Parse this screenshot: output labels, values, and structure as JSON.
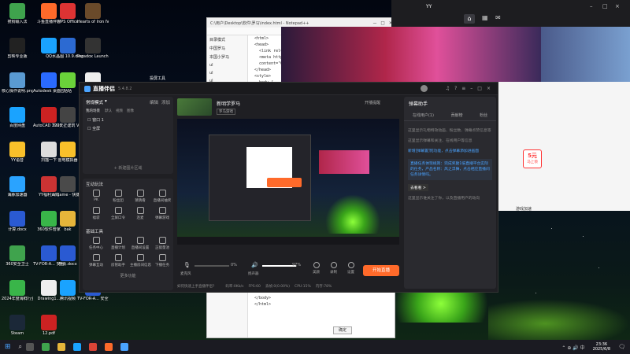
{
  "desktop": {
    "icons": [
      {
        "label": "搜狗输入法"
      },
      {
        "label": "斗鱼直播伴侣"
      },
      {
        "label": "WPS Office"
      },
      {
        "label": "Hearts of Iron IV"
      },
      {
        "label": "剪映专业版"
      },
      {
        "label": "QQ"
      },
      {
        "label": "水晶图 10.9.dwg"
      },
      {
        "label": "Paradox Launcher v2"
      },
      {
        "label": "核心操作说明.png"
      },
      {
        "label": "Autodesk 桌面应用程序"
      },
      {
        "label": "咕咕"
      },
      {
        "label": "Drawing1..."
      },
      {
        "label": "百度网盘"
      },
      {
        "label": "AutoCAD 2020 - 简体"
      },
      {
        "label": "T20天正建筑 V9.0"
      },
      {
        "label": "共享"
      },
      {
        "label": "YY语音"
      },
      {
        "label": "扫描一下"
      },
      {
        "label": "雷电模拟器"
      },
      {
        "label": "Microsoft Edge"
      },
      {
        "label": "海豚加速器"
      },
      {
        "label": "YY福利大厅"
      },
      {
        "label": "onqame - 快捷方式"
      },
      {
        "label": "网易云音乐"
      },
      {
        "label": "计算.docx"
      },
      {
        "label": "360软件管家"
      },
      {
        "label": "bak"
      },
      {
        "label": "Blender 4.2"
      },
      {
        "label": "360安全卫士"
      },
      {
        "label": "TV-FOR-A... 安全协议"
      },
      {
        "label": "参会.docx"
      },
      {
        "label": "微信"
      },
      {
        "label": "2024年度海鲜行业"
      },
      {
        "label": "Drawing1..."
      },
      {
        "label": "腾讯视频"
      },
      {
        "label": "TV-FOR-A... 安全协议"
      },
      {
        "label": "Steam"
      },
      {
        "label": "12.pdf"
      }
    ],
    "extra_label": "投屏工具"
  },
  "editor": {
    "title": "C:\\用户\\Desktop\\软件\\罗马\\index.html - Notepad++",
    "tree": [
      "目录模式",
      "中国罗马",
      "本国小罗马",
      "ul",
      "ul",
      "ul",
      "找机构",
      "前端罗马"
    ],
    "code_lines": [
      "<html>",
      "",
      "<head>",
      "  <link rel=\"stylesheet\" type=\"text/css\" href=\"styles.css\">",
      "  <meta http-equiv=\"refresh\"",
      "  content=\"0.5;url=https://www.aliyun.com/product/yunxiao/codeup\">",
      "</head>",
      "",
      "<style>",
      "  body {"
    ],
    "code_tail": [
      "</body>",
      "",
      "</html>"
    ],
    "ok_button": "确定"
  },
  "browser": {
    "top_label": "YY",
    "promo": "5元",
    "promo_sub": "马上领",
    "accel_label": "游戏加速"
  },
  "app": {
    "title": "直播伴侣",
    "version": "5.4.8.2",
    "mode": "常规模式",
    "edit": "编辑",
    "add": "添加",
    "scene_group": "我的场景",
    "scene_tabs": [
      "默认",
      "视频",
      "图像"
    ],
    "scenes": [
      "窗口 1",
      "全屏"
    ],
    "add_scene": "+ 新建图片区域",
    "interact_title": "互动玩法",
    "interact_tools": [
      "PK",
      "粉丝团",
      "猜猜看",
      "直播间抽奖",
      "福袋",
      "全屏口令",
      "连麦",
      "弹幕游戏"
    ],
    "basic_title": "基础工具",
    "basic_tools": [
      "任务中心",
      "直播计划",
      "直播间设置",
      "正能量池",
      "弹幕互动",
      "房管助手",
      "主播房间信息",
      "下播任务"
    ],
    "more_features": "更多功能",
    "stream_title": "新明学罗马",
    "tag": "罗马游戏",
    "obs_label": "开播提醒",
    "mic_label": "麦克风",
    "mic_value": "0%",
    "speaker_label": "扬声器",
    "speaker_value": "97%",
    "tool_labels": [
      "美颜",
      "录制",
      "设置"
    ],
    "live_button": "开始直播",
    "status_bar": "如何快速上手直播伴侣?",
    "stats": [
      "码率:0Kb/s",
      "FPS:60",
      "丢帧:0(0.00%)",
      "CPU:15%",
      "内存:78%"
    ],
    "right_title": "弹幕助手",
    "right_tabs": [
      "在线用户(1)",
      "贡献榜",
      "粉丝"
    ],
    "chat_lines": [
      "这里显示礼物特效动画、粉丝数、弹幕点赞信息等",
      "这里显示弹幕和关注、在线用户等信息",
      "新增[弹幕置顶]功能，点击弹幕添加进画面",
      "直播任务体现规则：完成奖励1倍直播平台实际的任务，产品名称：风之浮舞，点击相应直播间任务详情吗。",
      "这里显示谁关注了你，以及直播用户的动向"
    ],
    "view_more": "去看看 >"
  },
  "taskbar": {
    "time": "23:36",
    "date": "2025/6/8"
  },
  "colors": {
    "accent": "#ff6a2a",
    "chat_highlight": "#4aa3ff",
    "app_bg": "#1f1f23"
  }
}
